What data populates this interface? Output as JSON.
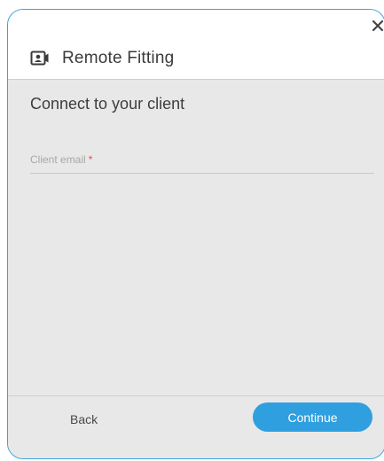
{
  "dialog": {
    "title": "Remote Fitting",
    "title_icon": "video-camera-icon",
    "close_icon": "close-icon"
  },
  "main": {
    "heading": "Connect to your client",
    "client_email": {
      "label": "Client email",
      "required_marker": "*",
      "value": ""
    }
  },
  "footer": {
    "back_label": "Back",
    "continue_label": "Continue"
  },
  "colors": {
    "accent": "#2f9fe0",
    "border": "#3aa3d9",
    "panel": "#e8e8e8",
    "required": "#d9534f"
  }
}
